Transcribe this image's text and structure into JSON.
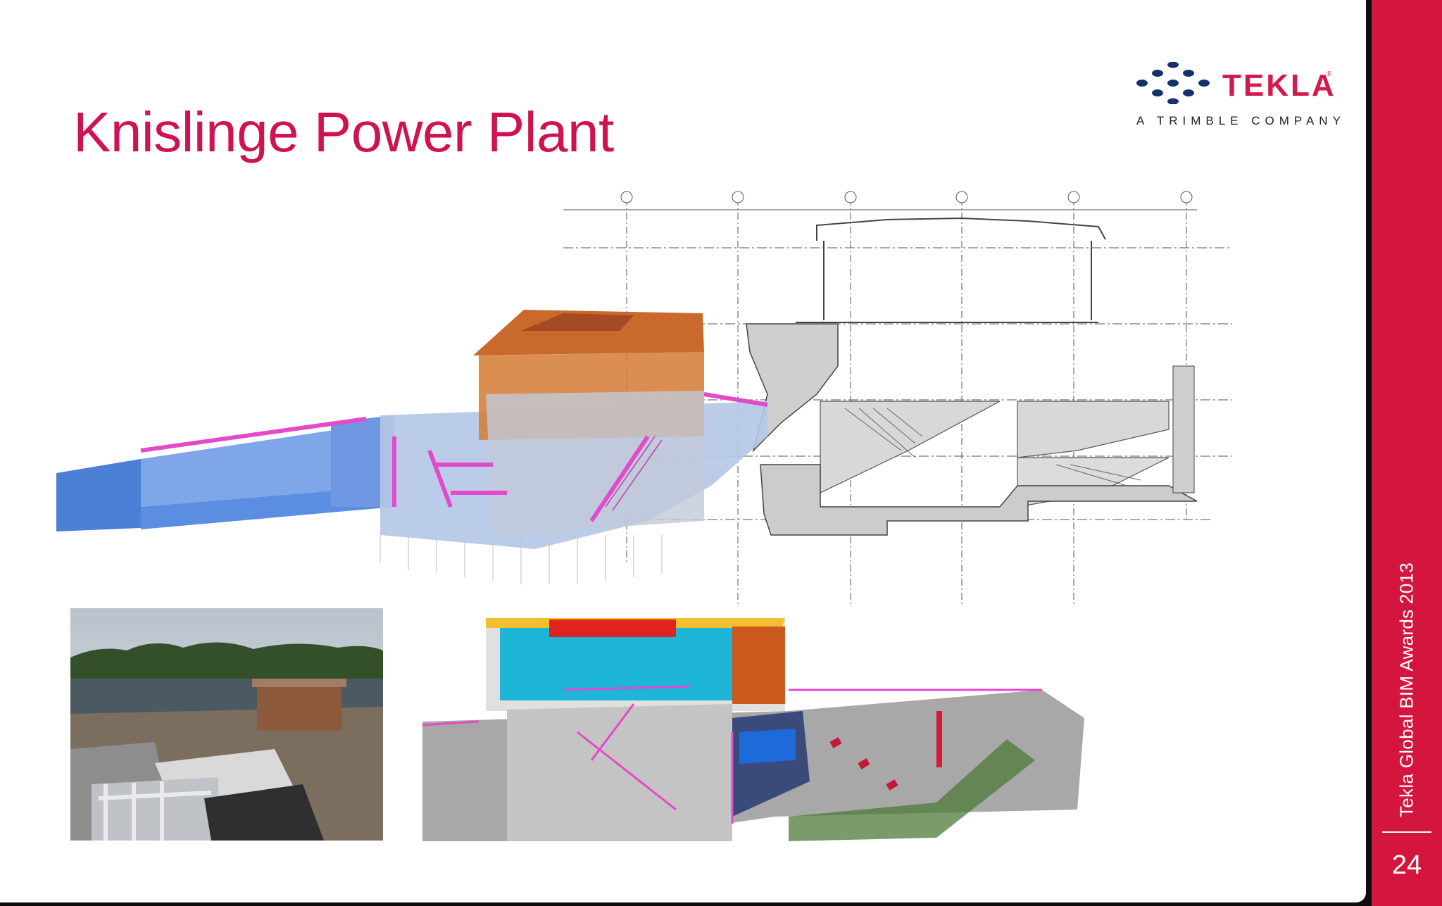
{
  "slide": {
    "title": "Knislinge Power Plant",
    "page_number": "24",
    "footer_caption": "Tekla Global BIM Awards 2013"
  },
  "logo": {
    "wordmark": "TEKLA",
    "registered": "®",
    "tagline": "A TRIMBLE COMPANY",
    "icon": "tekla-dots-icon"
  },
  "figures": [
    {
      "name": "3d-model-overview",
      "content": "3D BIM model render of the plant"
    },
    {
      "name": "cross-section-drawing",
      "content": "2D technical cross-section drawing"
    },
    {
      "name": "site-photo",
      "content": "Construction site photograph"
    },
    {
      "name": "3d-section-render",
      "content": "3D sectional model render"
    }
  ],
  "colors": {
    "title": "#cf1250",
    "sidebar": "#d4163f",
    "logo_mark": "#16306f",
    "logo_word": "#d21a4c"
  }
}
